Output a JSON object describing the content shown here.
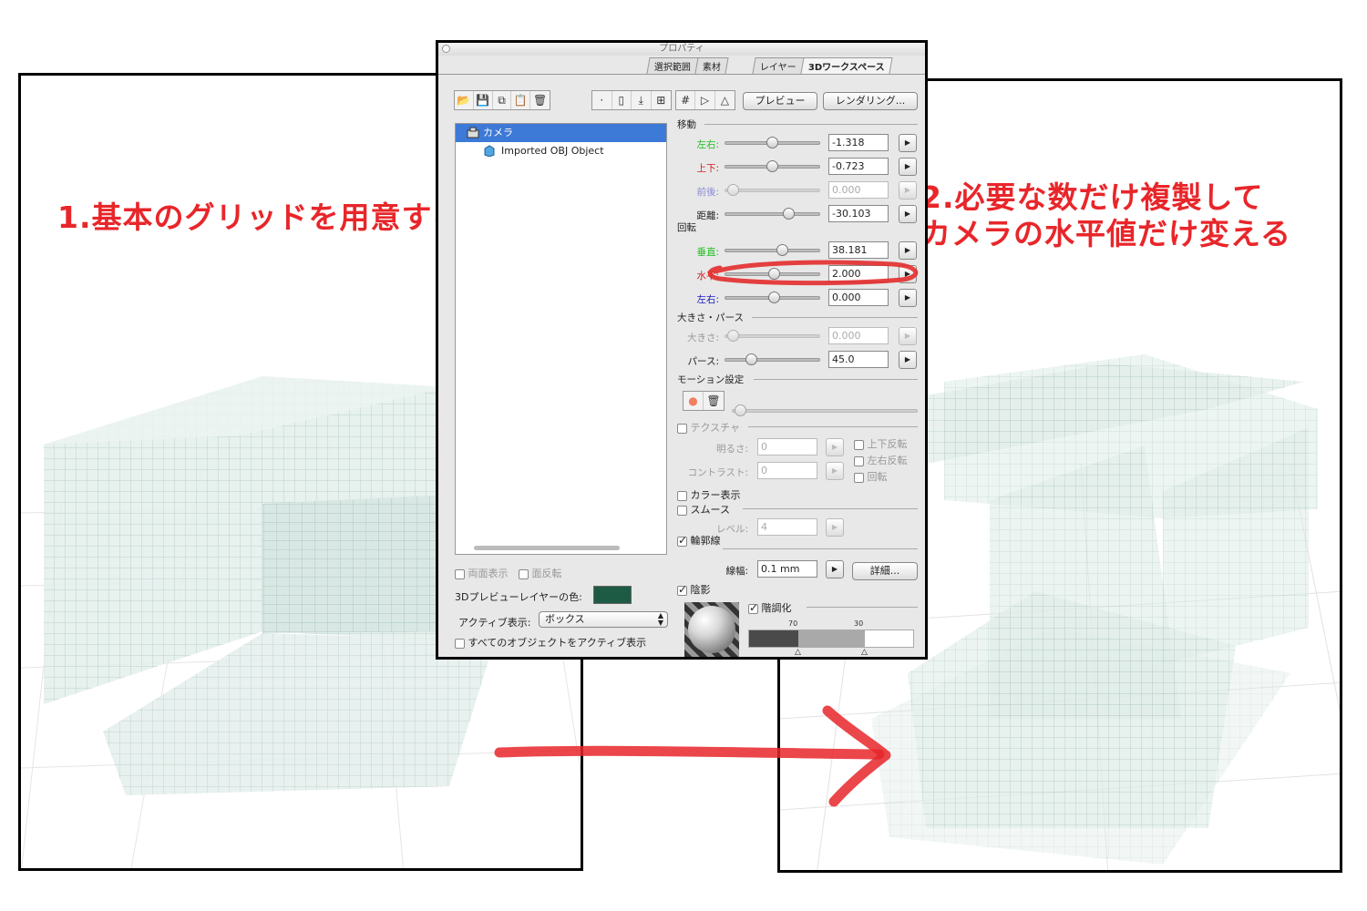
{
  "captions": {
    "step1": "1.基本のグリッドを用意する",
    "step2_line1": "2.必要な数だけ複製して",
    "step2_line2": "カメラの水平値だけ変える"
  },
  "dialog": {
    "title": "プロパティ",
    "tabs": [
      "選択範囲",
      "素材",
      "レイヤー",
      "3Dワークスペース"
    ],
    "active_tab": "3Dワークスペース",
    "preview_button": "プレビュー",
    "render_button": "レンダリング...",
    "tree": [
      {
        "label": "カメラ",
        "selected": true,
        "icon": "camera-icon"
      },
      {
        "label": "Imported OBJ Object",
        "selected": false,
        "icon": "cube-icon"
      }
    ],
    "both_sides": "両面表示",
    "flip_faces": "面反転",
    "layer_color_label": "3Dプレビューレイヤーの色:",
    "layer_color": "#1e5b44",
    "active_display_label": "アクティブ表示:",
    "active_display_value": "ボックス",
    "all_objects_active": "すべてのオブジェクトをアクティブ表示",
    "move_section": "移動",
    "rotate_section": "回転",
    "size_section": "大きさ・パース",
    "motion_section": "モーション設定",
    "params": {
      "move_lr": {
        "label": "左右:",
        "value": "-1.318",
        "color": "#22c022"
      },
      "move_ud": {
        "label": "上下:",
        "value": "-0.723",
        "color": "#d02020"
      },
      "move_fb": {
        "label": "前後:",
        "value": "0.000",
        "color": "#8a8ad8"
      },
      "distance": {
        "label": "距離:",
        "value": "-30.103",
        "color": "#222222"
      },
      "rot_v": {
        "label": "垂直:",
        "value": "38.181",
        "color": "#22c022"
      },
      "rot_h": {
        "label": "水平:",
        "value": "2.000",
        "color": "#d02020"
      },
      "rot_lr": {
        "label": "左右:",
        "value": "0.000",
        "color": "#2020c0"
      },
      "size": {
        "label": "大きさ:",
        "value": "0.000"
      },
      "perspective": {
        "label": "パース:",
        "value": "45.0"
      }
    },
    "texture": "テクスチャ",
    "brightness": {
      "label": "明るさ:",
      "value": "0"
    },
    "contrast": {
      "label": "コントラスト:",
      "value": "0"
    },
    "flip_v": "上下反転",
    "flip_h": "左右反転",
    "rotate": "回転",
    "color_display": "カラー表示",
    "smooth": "スムース",
    "level": {
      "label": "レベル:",
      "value": "4"
    },
    "outline": "輪郭線",
    "line_width": {
      "label": "線幅:",
      "value": "0.1 mm"
    },
    "details_button": "詳細...",
    "shadow": "陰影",
    "posterize": "階調化",
    "ramp_70": "70",
    "ramp_30": "30"
  }
}
